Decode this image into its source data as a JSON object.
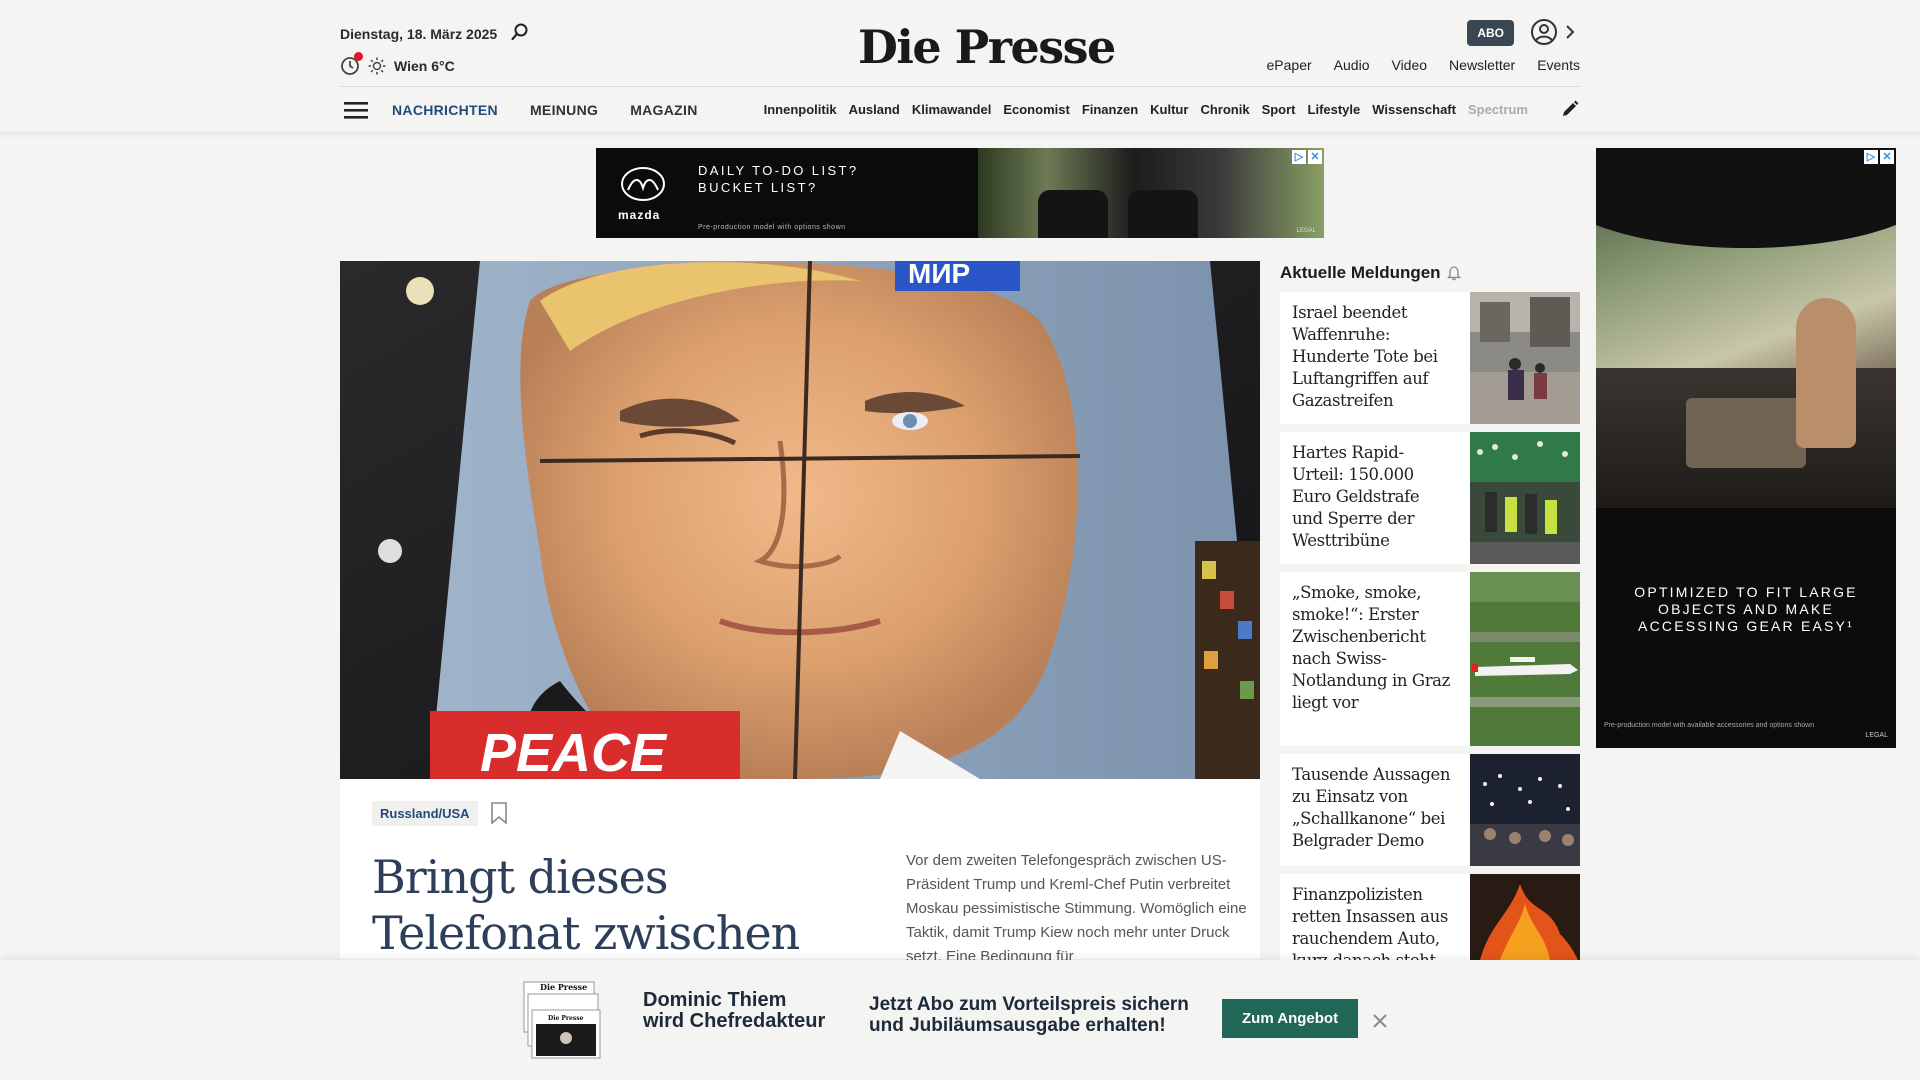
{
  "header": {
    "date": "Dienstag, 18. März 2025",
    "weather": "Wien 6°C",
    "logo": "Die Presse",
    "abo_badge": "ABO",
    "top_links": [
      "ePaper",
      "Audio",
      "Video",
      "Newsletter",
      "Events"
    ]
  },
  "nav": {
    "main": [
      "NACHRICHTEN",
      "MEINUNG",
      "MAGAZIN"
    ],
    "sub": [
      "Innenpolitik",
      "Ausland",
      "Klimawandel",
      "Economist",
      "Finanzen",
      "Kultur",
      "Chronik",
      "Sport",
      "Lifestyle",
      "Wissenschaft",
      "Spectrum"
    ]
  },
  "ads": {
    "top": {
      "brand": "mazda",
      "copy_line1": "DAILY TO-DO LIST?",
      "copy_line2": "BUCKET LIST?",
      "fine": "Pre-production model with options shown",
      "legal": "LEGAL"
    },
    "side": {
      "copy_line1": "OPTIMIZED TO FIT LARGE",
      "copy_line2": "OBJECTS AND MAKE",
      "copy_line3": "ACCESSING GEAR EASY¹",
      "fine": "Pre-production model with available accessories and options shown",
      "legal": "LEGAL"
    }
  },
  "hero": {
    "tag": "Russland/USA",
    "headline_line1": "Bringt dieses",
    "headline_line2": "Telefonat zwischen",
    "teaser": "Vor dem zweiten Telefongespräch zwischen US-Präsident Trump und Kreml-Chef Putin verbreitet Moskau pessimistische Stimmung. Womöglich eine Taktik, damit Trump Kiew noch mehr unter Druck setzt. Eine Bedingung für",
    "image_text_top": "МИР",
    "image_text_bottom": "PEACE"
  },
  "news": {
    "heading": "Aktuelle Meldungen",
    "items": [
      "Israel beendet Waffenruhe: Hunderte Tote bei Luftangriffen auf Gazastreifen",
      "Hartes Rapid-Urteil: 150.000 Euro Geldstrafe und Sperre der Westtribüne",
      "„Smoke, smoke, smoke!“: Erster Zwischenbericht nach Swiss-Notlandung in Graz liegt vor",
      "Tausende Aussagen zu Einsatz von „Schallkanone“ bei Belgrader Demo",
      "Finanzpolizisten retten Insassen aus rauchendem Auto, kurz danach steht"
    ]
  },
  "promo": {
    "title_line1": "Dominic Thiem",
    "title_line2": "wird Chefredakteur",
    "text_line1": "Jetzt Abo zum Vorteilspreis sichern",
    "text_line2": "und Jubiläumsausgabe erhalten!",
    "button": "Zum Angebot",
    "paper_logo": "Die Presse"
  },
  "colors": {
    "accent_blue": "#244a7a",
    "headline_blue": "#2c3e5a",
    "promo_green": "#216656",
    "abo_badge": "#3a4654",
    "notification_red": "#e0182a"
  }
}
